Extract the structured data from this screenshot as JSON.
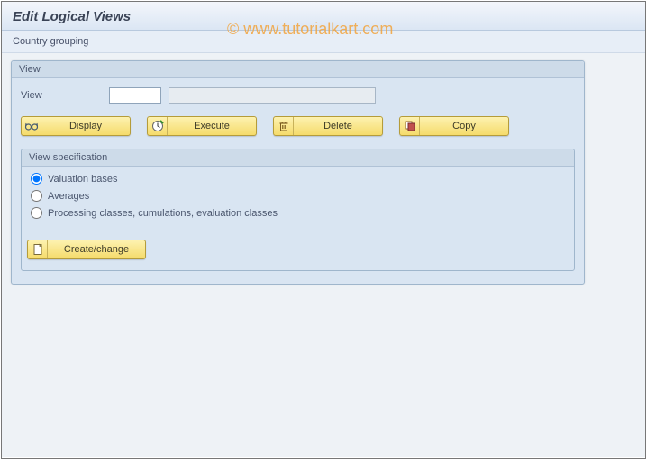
{
  "header": {
    "title": "Edit Logical Views",
    "subtitle": "Country grouping"
  },
  "watermark": "© www.tutorialkart.com",
  "viewGroup": {
    "title": "View",
    "fieldLabel": "View",
    "codeValue": "",
    "descValue": "",
    "buttons": {
      "display": "Display",
      "execute": "Execute",
      "delete": "Delete",
      "copy": "Copy"
    }
  },
  "specGroup": {
    "title": "View specification",
    "options": {
      "valuation": "Valuation bases",
      "averages": "Averages",
      "processing": "Processing classes, cumulations, evaluation classes"
    },
    "createBtn": "Create/change"
  }
}
